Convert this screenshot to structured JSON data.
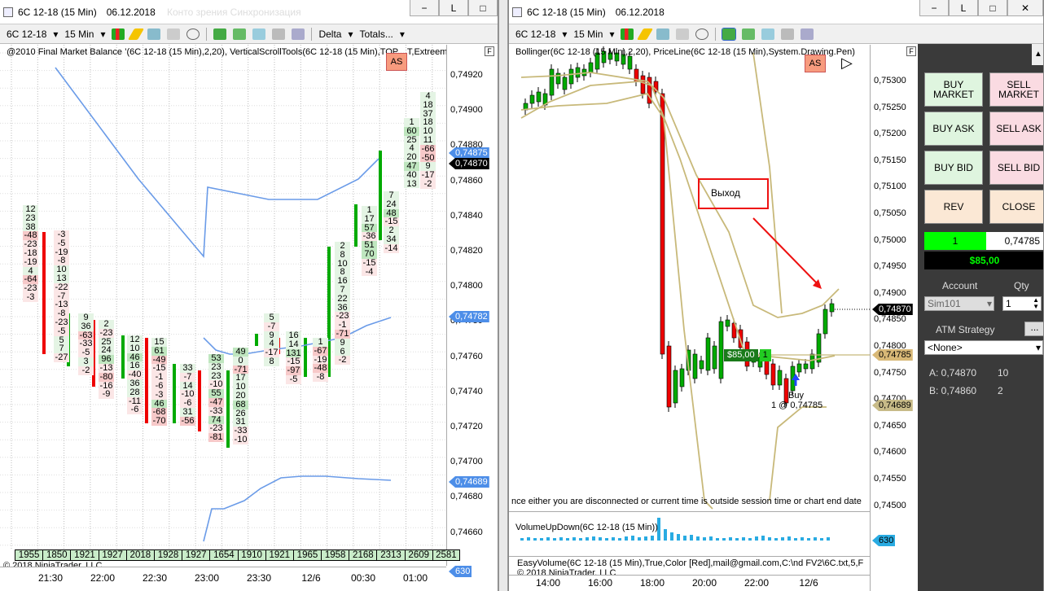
{
  "left": {
    "title": "6C 12-18 (15 Min)",
    "date": "06.12.2018",
    "faded_tabs": "Конто зрения                   Синхронизация",
    "toolbar": {
      "instrument": "6C 12-18",
      "period": "15 Min",
      "delta": "Delta",
      "totals": "Totals..."
    },
    "indicator_header": "@2010 Final Market Balance  ’(6C 12-18 (15 Min),2,20), VerticalScrollTools(6C 12-18 (15 Min),TOP,...T,Extreem",
    "as_label": "AS",
    "f_label": "F",
    "price_labels": [
      "0,74920",
      "0,74900",
      "0,74880",
      "0,74860",
      "0,74840",
      "0,74820",
      "0,74800",
      "0,74780",
      "0,74760",
      "0,74740",
      "0,74720",
      "0,74700",
      "0,74680",
      "0,74660"
    ],
    "tags": [
      {
        "text": "0,74875",
        "color": "#4d8ee8",
        "fg": "#fff"
      },
      {
        "text": "0,74870",
        "color": "#000",
        "fg": "#fff"
      },
      {
        "text": "0,74782",
        "color": "#4d8ee8",
        "fg": "#fff"
      },
      {
        "text": "0,74689",
        "color": "#4d8ee8",
        "fg": "#fff"
      },
      {
        "text": "630",
        "color": "#4d8ee8",
        "fg": "#fff"
      }
    ],
    "totals": [
      "1955",
      "1850",
      "1921",
      "1927",
      "2018",
      "1928",
      "1927",
      "1654",
      "1910",
      "1921",
      "1965",
      "1958",
      "2168",
      "2313",
      "2609",
      "2581"
    ],
    "copyright": "© 2018 NinjaTrader, LLC",
    "time_labels": [
      "21:30",
      "22:00",
      "22:30",
      "23:00",
      "23:30",
      "12/6",
      "00:30",
      "01:00"
    ],
    "columns": [
      {
        "vals": [
          "12",
          "23",
          "38",
          "-48",
          "-23",
          "-18",
          "-19",
          "4",
          "-64",
          "-23",
          "-3"
        ]
      },
      {
        "vals": [
          "-3",
          "-5",
          "-19",
          "-8",
          "10",
          "13",
          "-22",
          "-7",
          "-13",
          "-8",
          "-23",
          "-5",
          "5",
          "7",
          "-27"
        ]
      },
      {
        "vals": [
          "9",
          "36",
          "-63",
          "-33",
          "-5",
          "3",
          "-2"
        ]
      },
      {
        "vals": [
          "2",
          "-23",
          "25",
          "24",
          "96",
          "-13",
          "-80",
          "-16",
          "-9"
        ]
      },
      {
        "vals": [
          "12",
          "10",
          "46",
          "16",
          "-40",
          "36",
          "28",
          "-11",
          "-6"
        ]
      },
      {
        "vals": [
          "15",
          "61",
          "-49",
          "-15",
          "-1",
          "-6",
          "-3",
          "46",
          "-68",
          "-70"
        ]
      },
      {
        "vals": [
          "33",
          "-7",
          "14",
          "-10",
          "-6",
          "31",
          "-56"
        ]
      },
      {
        "vals": [
          "53",
          "23",
          "23",
          "-10",
          "55",
          "-47",
          "-33",
          "74",
          "-23",
          "-81"
        ]
      },
      {
        "vals": [
          "49",
          "0",
          "-71",
          "17",
          "10",
          "20",
          "68",
          "26",
          "31",
          "-33",
          "-10"
        ]
      },
      {
        "vals": [
          "5",
          "-7",
          "9",
          "4",
          "-17",
          "8"
        ]
      },
      {
        "vals": [
          "16",
          "14",
          "131",
          "-15",
          "-97",
          "-5"
        ]
      },
      {
        "vals": [
          "1",
          "-67",
          "-19",
          "-48",
          "-8"
        ]
      },
      {
        "vals": [
          "2",
          "8",
          "10",
          "8",
          "16",
          "7",
          "22",
          "36",
          "-23",
          "-1",
          "-71",
          "9",
          "6",
          "-2"
        ]
      },
      {
        "vals": [
          "1",
          "17",
          "57",
          "-36",
          "51",
          "70",
          "-15",
          "-4"
        ]
      },
      {
        "vals": [
          "7",
          "24",
          "48",
          "-15",
          "2",
          "34",
          "-14"
        ]
      },
      {
        "vals": [
          "1",
          "60",
          "25",
          "4",
          "20",
          "47",
          "40",
          "13"
        ]
      },
      {
        "vals": [
          "4",
          "18",
          "37",
          "18",
          "10",
          "11",
          "-66",
          "-50",
          "9",
          "-17",
          "-2"
        ]
      }
    ]
  },
  "right": {
    "title": "6C 12-18 (15 Min)",
    "date": "06.12.2018",
    "toolbar": {
      "instrument": "6C 12-18",
      "period": "15 Min"
    },
    "indicator_header": "Bollinger(6C 12-18 (15 Min),2,20), PriceLine(6C 12-18 (15 Min),System.Drawing.Pen)",
    "as_label": "AS",
    "f_label": "F",
    "annotation": "Выход",
    "price_labels": [
      "0,75300",
      "0,75250",
      "0,75200",
      "0,75150",
      "0,75100",
      "0,75050",
      "0,75000",
      "0,74950",
      "0,74900",
      "0,74850",
      "0,74800",
      "0,74750",
      "0,74700",
      "0,74650",
      "0,74600",
      "0,74550",
      "0,74500"
    ],
    "tags": [
      {
        "text": "0,74870",
        "color": "#000",
        "fg": "#fff"
      },
      {
        "text": "0,74785",
        "color": "#d8b877",
        "fg": "#000"
      },
      {
        "text": "0,74689",
        "color": "#c8bb88",
        "fg": "#000"
      },
      {
        "text": "630",
        "color": "#29abe2",
        "fg": "#000"
      }
    ],
    "position_box": {
      "pnl": "$85,00",
      "qty": "1"
    },
    "buy_label": "Buy",
    "fill_label": "1 @ 0,74785",
    "session_msg": "nce either you are disconnected or current time is outside session time or chart end date",
    "volume_header": "VolumeUpDown(6C 12-18 (15 Min))",
    "easyvolume": "EasyVolume(6C 12-18 (15 Min),True,Color [Red],mail@gmail.com,C:\\nd FV2\\6C.txt,5,F",
    "copyright": "© 2018 NinjaTrader, LLC",
    "time_labels": [
      "14:00",
      "16:00",
      "18:00",
      "20:00",
      "22:00",
      "12/6"
    ],
    "side": {
      "buy_market": "BUY MARKET",
      "sell_market": "SELL MARKET",
      "buy_ask": "BUY ASK",
      "sell_ask": "SELL ASK",
      "buy_bid": "BUY BID",
      "sell_bid": "SELL BID",
      "rev": "REV",
      "close": "CLOSE",
      "pos_qty": "1",
      "pos_price": "0,74785",
      "pnl": "$85,00",
      "account_label": "Account",
      "qty_label": "Qty",
      "account": "Sim101",
      "qty": "1",
      "atm_label": "ATM Strategy",
      "atm": "<None>",
      "ask_label": "A: 0,74870",
      "ask_size": "10",
      "bid_label": "B: 0,74860",
      "bid_size": "2",
      "more": "..."
    }
  }
}
